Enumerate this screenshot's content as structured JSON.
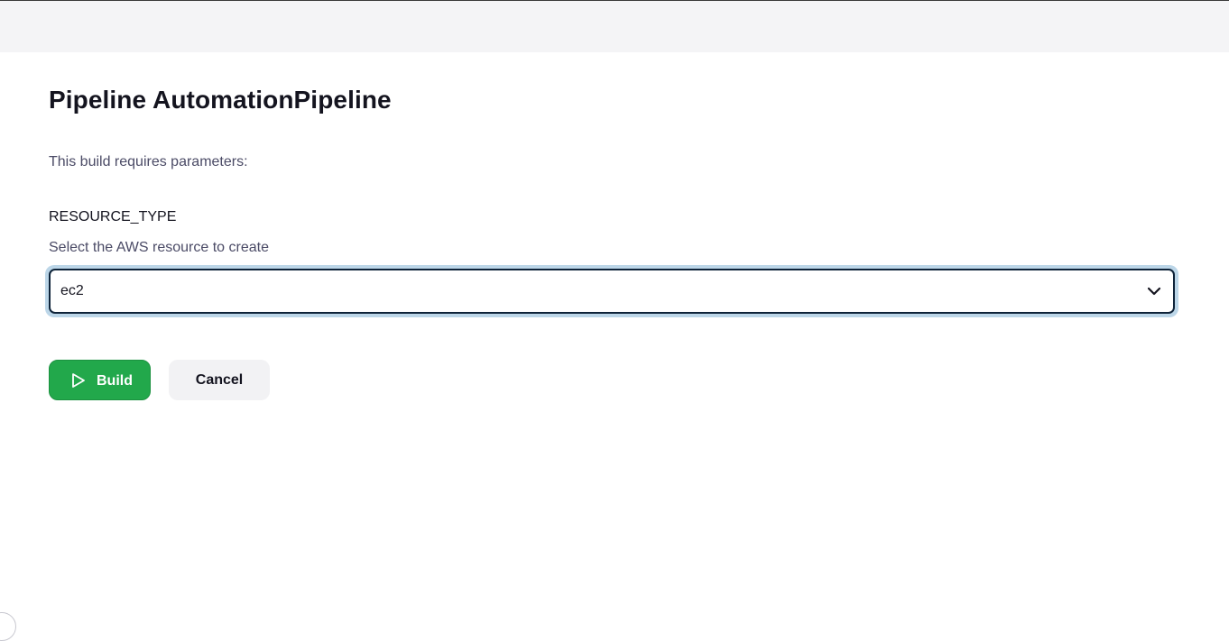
{
  "page": {
    "title": "Pipeline AutomationPipeline",
    "intro": "This build requires parameters:"
  },
  "parameter": {
    "name": "RESOURCE_TYPE",
    "description": "Select the AWS resource to create",
    "selected_value": "ec2",
    "dropdown_icon": "chevron-down-icon"
  },
  "actions": {
    "build_label": "Build",
    "build_icon": "play-icon",
    "cancel_label": "Cancel"
  },
  "colors": {
    "build_button": "#22a84b",
    "select_focus_ring": "#bcd6e8",
    "select_border": "#0e2339",
    "top_bar": "#f4f4f6"
  }
}
